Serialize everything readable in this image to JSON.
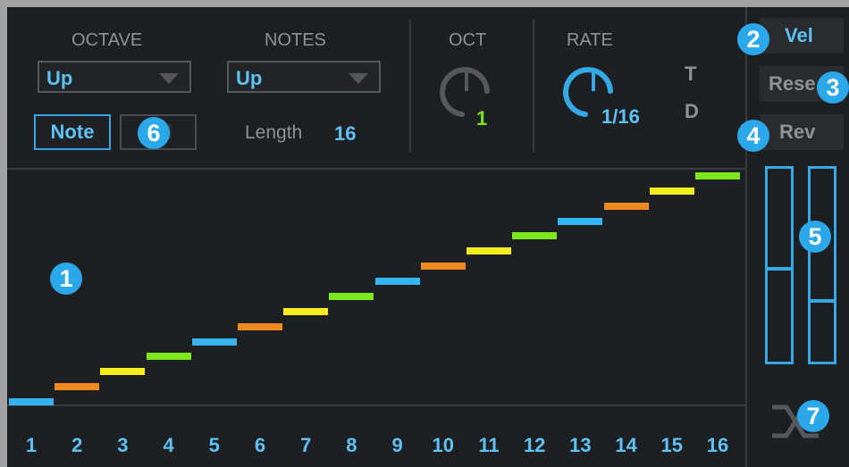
{
  "header": {
    "octave_label": "OCTAVE",
    "octave_value": "Up",
    "notes_label": "NOTES",
    "notes_value": "Up",
    "note_button": "Note",
    "vel_small_button": "Vel",
    "length_label": "Length",
    "length_value": "16",
    "oct_label": "OCT",
    "oct_value": "1",
    "rate_label": "RATE",
    "rate_value": "1/16",
    "t_label": "T",
    "d_label": "D"
  },
  "side": {
    "vel_button": "Vel",
    "reset_button": "Rese",
    "rev_button": "Rev",
    "slider_left_level": 0.48,
    "slider_right_level": 0.31
  },
  "badges": [
    "1",
    "2",
    "3",
    "4",
    "5",
    "6",
    "7"
  ],
  "steps": {
    "numbers": [
      "1",
      "2",
      "3",
      "4",
      "5",
      "6",
      "7",
      "8",
      "9",
      "10",
      "11",
      "12",
      "13",
      "14",
      "15",
      "16"
    ],
    "colors": [
      "#34b4f0",
      "#ef8a1f",
      "#f4ee1e",
      "#7ce81d",
      "#34b4f0",
      "#ef8a1f",
      "#f4ee1e",
      "#7ce81d",
      "#34b4f0",
      "#ef8a1f",
      "#f4ee1e",
      "#7ce81d",
      "#34b4f0",
      "#ef8a1f",
      "#f4ee1e",
      "#7ce81d"
    ]
  },
  "colors": {
    "accent": "#5fc2f4",
    "green": "#7ce81d",
    "badge": "#2ba8ea"
  }
}
